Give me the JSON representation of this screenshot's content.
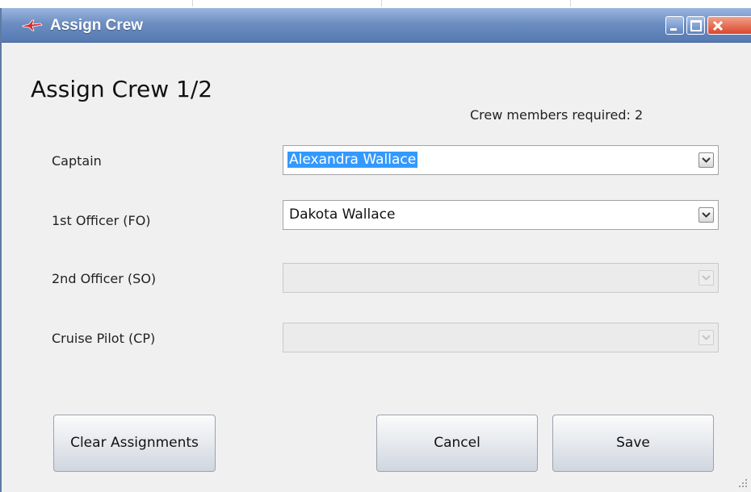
{
  "window": {
    "title": "Assign Crew",
    "controls": {
      "minimize": "minimize-icon",
      "maximize": "maximize-icon",
      "close": "close-icon"
    }
  },
  "form": {
    "heading": "Assign Crew 1/2",
    "required_text": "Crew members required: 2",
    "fields": [
      {
        "label": "Captain",
        "value": "Alexandra Wallace",
        "enabled": true,
        "selected": true
      },
      {
        "label": "1st Officer (FO)",
        "value": "Dakota Wallace",
        "enabled": true,
        "selected": false
      },
      {
        "label": "2nd Officer (SO)",
        "value": "",
        "enabled": false,
        "selected": false
      },
      {
        "label": "Cruise Pilot (CP)",
        "value": "",
        "enabled": false,
        "selected": false
      }
    ]
  },
  "buttons": {
    "clear": "Clear Assignments",
    "cancel": "Cancel",
    "save": "Save"
  },
  "colors": {
    "titlebar": "#6d8ec2",
    "selection": "#3399ff",
    "close_button": "#d9462b"
  }
}
